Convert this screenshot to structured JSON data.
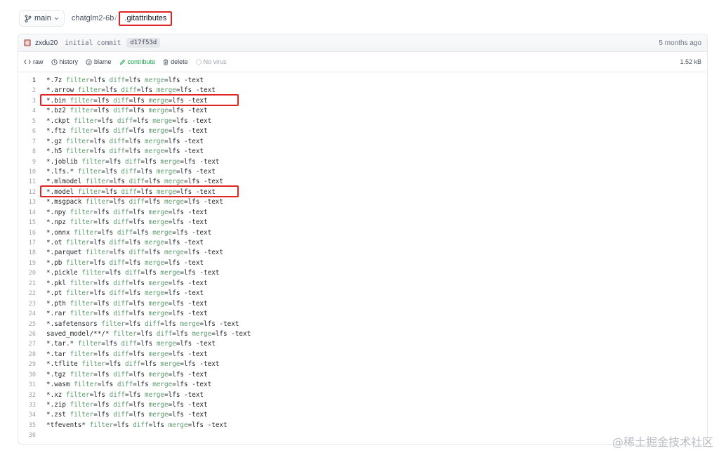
{
  "header": {
    "branch_label": "main",
    "branch_icon": "git-branch-icon",
    "repo_name": "chatglm2-6b",
    "separator": "/",
    "current_file": ".gitattributes"
  },
  "commit": {
    "author": "zxdu20",
    "message": "initial commit",
    "hash": "d17f53d",
    "time": "5 months ago"
  },
  "actions": {
    "raw": "raw",
    "history": "history",
    "blame": "blame",
    "contribute": "contribute",
    "delete": "delete",
    "no_virus": "No virus",
    "file_size": "1.52 kB"
  },
  "code": {
    "highlighted_lines": [
      3,
      12
    ],
    "lines": [
      {
        "n": "1",
        "pattern": "*.7z"
      },
      {
        "n": "2",
        "pattern": "*.arrow"
      },
      {
        "n": "3",
        "pattern": "*.bin"
      },
      {
        "n": "4",
        "pattern": "*.bz2"
      },
      {
        "n": "5",
        "pattern": "*.ckpt"
      },
      {
        "n": "6",
        "pattern": "*.ftz"
      },
      {
        "n": "7",
        "pattern": "*.gz"
      },
      {
        "n": "8",
        "pattern": "*.h5"
      },
      {
        "n": "9",
        "pattern": "*.joblib"
      },
      {
        "n": "10",
        "pattern": "*.lfs.*"
      },
      {
        "n": "11",
        "pattern": "*.mlmodel"
      },
      {
        "n": "12",
        "pattern": "*.model"
      },
      {
        "n": "13",
        "pattern": "*.msgpack"
      },
      {
        "n": "14",
        "pattern": "*.npy"
      },
      {
        "n": "15",
        "pattern": "*.npz"
      },
      {
        "n": "16",
        "pattern": "*.onnx"
      },
      {
        "n": "17",
        "pattern": "*.ot"
      },
      {
        "n": "18",
        "pattern": "*.parquet"
      },
      {
        "n": "19",
        "pattern": "*.pb"
      },
      {
        "n": "20",
        "pattern": "*.pickle"
      },
      {
        "n": "21",
        "pattern": "*.pkl"
      },
      {
        "n": "22",
        "pattern": "*.pt"
      },
      {
        "n": "23",
        "pattern": "*.pth"
      },
      {
        "n": "24",
        "pattern": "*.rar"
      },
      {
        "n": "25",
        "pattern": "*.safetensors"
      },
      {
        "n": "26",
        "pattern": "saved_model/**/*"
      },
      {
        "n": "27",
        "pattern": "*.tar.*"
      },
      {
        "n": "28",
        "pattern": "*.tar"
      },
      {
        "n": "29",
        "pattern": "*.tflite"
      },
      {
        "n": "30",
        "pattern": "*.tgz"
      },
      {
        "n": "31",
        "pattern": "*.wasm"
      },
      {
        "n": "32",
        "pattern": "*.xz"
      },
      {
        "n": "33",
        "pattern": "*.zip"
      },
      {
        "n": "34",
        "pattern": "*.zst"
      },
      {
        "n": "35",
        "pattern": "*tfevents*"
      },
      {
        "n": "36",
        "pattern": ""
      }
    ],
    "tokens": {
      "filter": "filter",
      "diff": "diff",
      "merge": "merge",
      "eq": "=",
      "value": "lfs",
      "text_attr": "-text"
    }
  },
  "watermark": "@稀土掘金技术社区",
  "colors": {
    "highlight_border": "#e02424",
    "contribute_green": "#16a34a",
    "attribute_key": "#5a9a6b"
  }
}
